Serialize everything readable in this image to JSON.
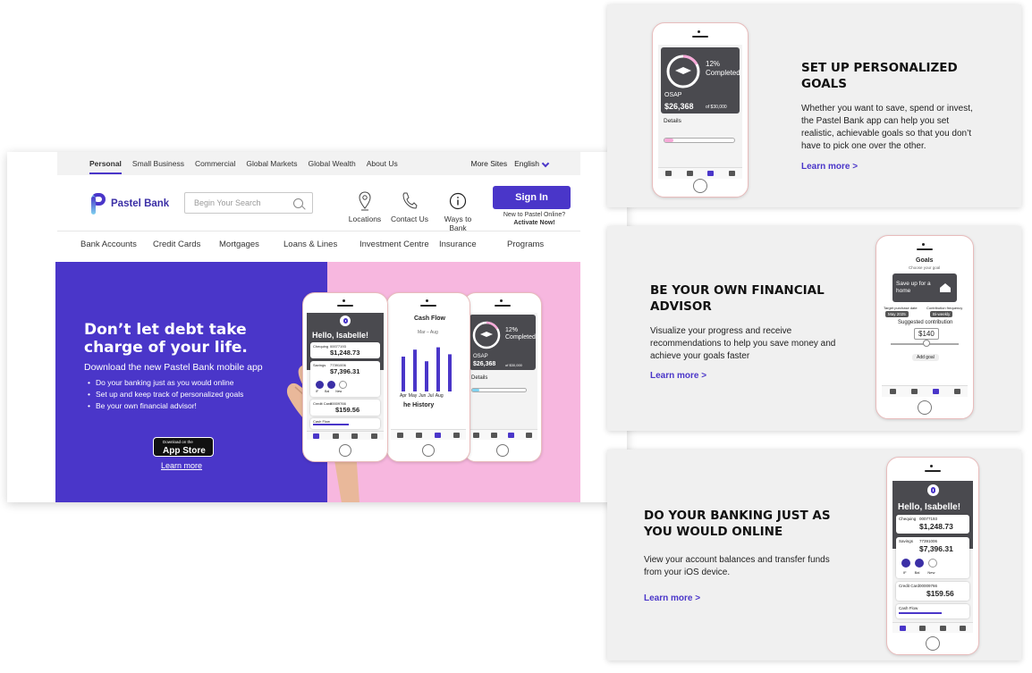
{
  "topbar": {
    "links": [
      "Personal",
      "Small Business",
      "Commercial",
      "Global Markets",
      "Global Wealth",
      "About Us"
    ],
    "more_sites": "More Sites",
    "language": "English"
  },
  "brand": {
    "name": "Pastel Bank"
  },
  "search": {
    "placeholder": "Begin Your Search"
  },
  "quick_links": {
    "locations": "Locations",
    "contact": "Contact Us",
    "ways": "Ways to Bank"
  },
  "signin": {
    "label": "Sign In",
    "new_to": "New to Pastel Online?",
    "activate": "Activate Now!"
  },
  "nav": [
    "Bank Accounts",
    "Credit Cards",
    "Mortgages",
    "Loans & Lines",
    "Investment Centre",
    "Insurance",
    "Programs"
  ],
  "hero": {
    "title": "Don’t let debt take charge of your life.",
    "subtitle": "Download the new Pastel Bank mobile app",
    "bullets": [
      "Do your banking just as you would online",
      "Set up and keep track of personalized goals",
      "Be your own financial advisor!"
    ],
    "appstore_small": "Download on the",
    "appstore_big": "App Store",
    "learn_more": "Learn more"
  },
  "app": {
    "greeting": "Hello, Isabelle!",
    "chequing_label": "Chequing",
    "chequing_acct": "00077193",
    "chequing_amount": "$1,248.73",
    "savings_label": "Savings",
    "savings_acct": "77391006",
    "savings_amount": "$7,396.31",
    "credit_label": "Credit Card",
    "credit_acct": "00009766",
    "credit_amount": "$159.56",
    "cashflow": "Cash Flow",
    "actions": [
      "IF",
      "Bal",
      "New"
    ],
    "month_range": "Mar – Aug",
    "months": [
      "Apr",
      "May",
      "Jun",
      "Jul",
      "Aug"
    ],
    "history": "he History",
    "goal_pct": "12%",
    "goal_completed": "Completed",
    "goal_name": "OSAP",
    "goal_amount": "$26,368",
    "goal_of": "of $30,000",
    "details": "Details",
    "goals_title": "Goals",
    "choose_goal": "Choose your goal",
    "save_home": "Save up for a home",
    "target_date_label": "Target purchase date",
    "target_date": "May 2025",
    "freq_label": "Contribution frequency",
    "freq": "Bi-weekly",
    "suggested": "Suggested contribution",
    "suggested_amount": "$140",
    "add_goal": "Add goal"
  },
  "panels": [
    {
      "title": "SET UP PERSONALIZED GOALS",
      "body": "Whether you want to save, spend or invest, the Pastel Bank app can help you set realistic, achievable goals so that you don’t have to pick one over the other.",
      "learn": "Learn more >"
    },
    {
      "title": "BE YOUR OWN FINANCIAL ADVISOR",
      "body": "Visualize your progress and receive recommendations to help you save money and achieve your goals faster",
      "learn": "Learn more >"
    },
    {
      "title": "DO YOUR BANKING JUST AS YOU WOULD ONLINE",
      "body": "View your account balances and transfer funds from your iOS device.",
      "learn": "Learn more >"
    }
  ],
  "colors": {
    "brand_purple": "#4a36c9",
    "hero_pink": "#f7b7df",
    "panel_bg": "#f0f0f0"
  }
}
